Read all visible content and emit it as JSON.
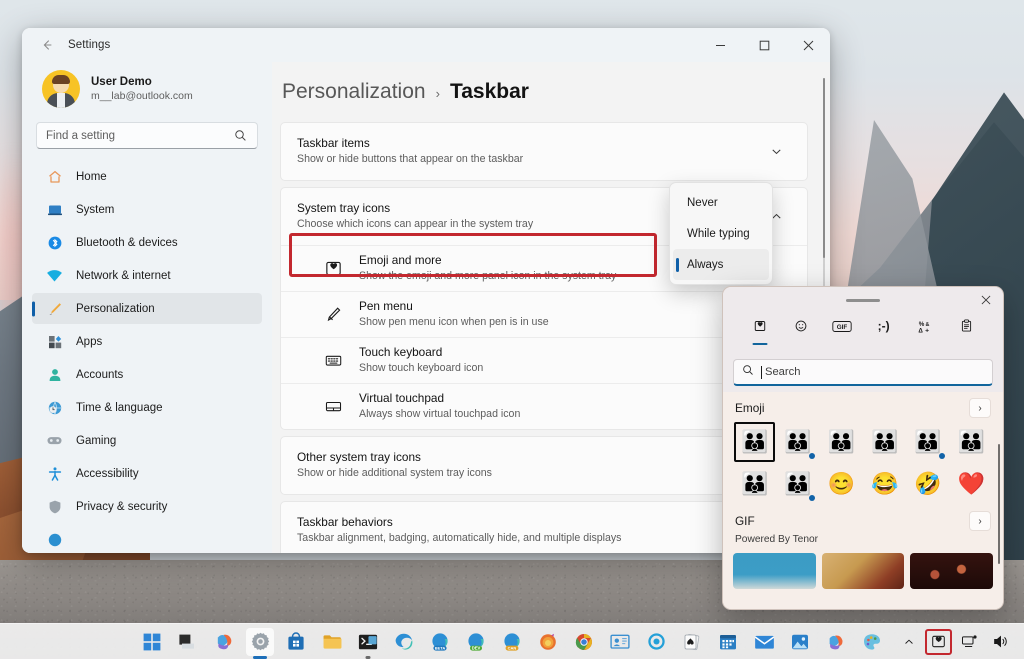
{
  "window": {
    "title": "Settings",
    "back_label": "Back",
    "minimize_label": "Minimize",
    "maximize_label": "Maximize",
    "close_label": "Close"
  },
  "account": {
    "name": "User Demo",
    "email": "m__lab@outlook.com"
  },
  "search": {
    "placeholder": "Find a setting",
    "value": ""
  },
  "sidebar": {
    "items": [
      {
        "label": "Home",
        "icon": "home-icon"
      },
      {
        "label": "System",
        "icon": "system-icon"
      },
      {
        "label": "Bluetooth & devices",
        "icon": "bluetooth-icon"
      },
      {
        "label": "Network & internet",
        "icon": "wifi-icon"
      },
      {
        "label": "Personalization",
        "icon": "brush-icon"
      },
      {
        "label": "Apps",
        "icon": "apps-icon"
      },
      {
        "label": "Accounts",
        "icon": "account-icon"
      },
      {
        "label": "Time & language",
        "icon": "clock-globe-icon"
      },
      {
        "label": "Gaming",
        "icon": "gamepad-icon"
      },
      {
        "label": "Accessibility",
        "icon": "accessibility-icon"
      },
      {
        "label": "Privacy & security",
        "icon": "shield-icon"
      }
    ],
    "active_index": 4
  },
  "breadcrumb": {
    "parent": "Personalization",
    "separator": "›",
    "current": "Taskbar"
  },
  "main": {
    "cards": [
      {
        "title": "Taskbar items",
        "subtitle": "Show or hide buttons that appear on the taskbar",
        "chevron": "chevron-down-icon"
      },
      {
        "title": "System tray icons",
        "subtitle": "Choose which icons can appear in the system tray",
        "chevron": "chevron-up-icon",
        "rows": [
          {
            "title": "Emoji and more",
            "subtitle": "Show the emoji and more panel icon in the system tray",
            "icon": "emoji-panel-icon",
            "value": "",
            "highlighted": true
          },
          {
            "title": "Pen menu",
            "subtitle": "Show pen menu icon when pen is in use",
            "icon": "pen-icon",
            "value": ""
          },
          {
            "title": "Touch keyboard",
            "subtitle": "Show touch keyboard icon",
            "icon": "keyboard-icon",
            "value": "Never"
          },
          {
            "title": "Virtual touchpad",
            "subtitle": "Always show virtual touchpad icon",
            "icon": "touchpad-icon",
            "value": ""
          }
        ]
      },
      {
        "title": "Other system tray icons",
        "subtitle": "Show or hide additional system tray icons",
        "chevron": ""
      },
      {
        "title": "Taskbar behaviors",
        "subtitle": "Taskbar alignment, badging, automatically hide, and multiple displays",
        "chevron": ""
      }
    ]
  },
  "dropdown": {
    "options": [
      "Never",
      "While typing",
      "Always"
    ],
    "selected": "Always"
  },
  "emoji_panel": {
    "close_label": "Close",
    "tabs": [
      {
        "name": "recent-tab",
        "glyph": "♥",
        "label": "Recently used"
      },
      {
        "name": "emoji-tab",
        "glyph": "☺",
        "label": "Emoji"
      },
      {
        "name": "gif-tab",
        "glyph": "GIF",
        "label": "GIF"
      },
      {
        "name": "kaomoji-tab",
        "glyph": ";-)",
        "label": "Kaomoji"
      },
      {
        "name": "symbols-tab",
        "glyph": "%&",
        "label": "Symbols"
      },
      {
        "name": "clipboard-tab",
        "glyph": "Ὄb",
        "label": "Clipboard history"
      }
    ],
    "active_tab_index": 0,
    "search": {
      "placeholder": "Search",
      "value": "Search"
    },
    "sections": [
      {
        "title": "Emoji",
        "more": "›",
        "emojis": [
          {
            "char": "👪",
            "selected": true,
            "dot": false
          },
          {
            "char": "👪",
            "selected": false,
            "dot": true
          },
          {
            "char": "👪",
            "selected": false,
            "dot": false
          },
          {
            "char": "👪",
            "selected": false,
            "dot": false
          },
          {
            "char": "👪",
            "selected": false,
            "dot": true
          },
          {
            "char": "👪",
            "selected": false,
            "dot": false
          },
          {
            "char": "👪",
            "selected": false,
            "dot": false
          },
          {
            "char": "👪",
            "selected": false,
            "dot": true
          },
          {
            "char": "😊",
            "selected": false,
            "dot": false
          },
          {
            "char": "😂",
            "selected": false,
            "dot": false
          },
          {
            "char": "🤣",
            "selected": false,
            "dot": false
          },
          {
            "char": "❤️",
            "selected": false,
            "dot": false
          }
        ]
      },
      {
        "title": "GIF",
        "subtitle": "Powered By Tenor",
        "more": "›",
        "thumbs": [
          "gif-thumb-1",
          "gif-thumb-2",
          "gif-thumb-3"
        ]
      }
    ]
  },
  "taskbar": {
    "apps": [
      {
        "name": "start-button",
        "state": ""
      },
      {
        "name": "task-view-button",
        "state": ""
      },
      {
        "name": "copilot-button",
        "state": ""
      },
      {
        "name": "settings-button",
        "state": "active"
      },
      {
        "name": "microsoft-store-button",
        "state": ""
      },
      {
        "name": "file-explorer-button",
        "state": ""
      },
      {
        "name": "terminal-button",
        "state": "running"
      },
      {
        "name": "edge-button",
        "state": ""
      },
      {
        "name": "edge-beta-button",
        "state": ""
      },
      {
        "name": "edge-dev-button",
        "state": ""
      },
      {
        "name": "edge-canary-button",
        "state": ""
      },
      {
        "name": "firefox-button",
        "state": ""
      },
      {
        "name": "chrome-button",
        "state": ""
      },
      {
        "name": "remote-desktop-button",
        "state": ""
      },
      {
        "name": "cortana-button",
        "state": ""
      },
      {
        "name": "solitaire-button",
        "state": ""
      },
      {
        "name": "calendar-button",
        "state": ""
      },
      {
        "name": "mail-button",
        "state": ""
      },
      {
        "name": "photos-button",
        "state": ""
      },
      {
        "name": "office-button",
        "state": ""
      },
      {
        "name": "paint-button",
        "state": ""
      }
    ],
    "tray": {
      "overflow": "chevron-up-icon",
      "emoji": "emoji-tray-icon",
      "network": "network-icon",
      "volume": "volume-icon"
    }
  }
}
